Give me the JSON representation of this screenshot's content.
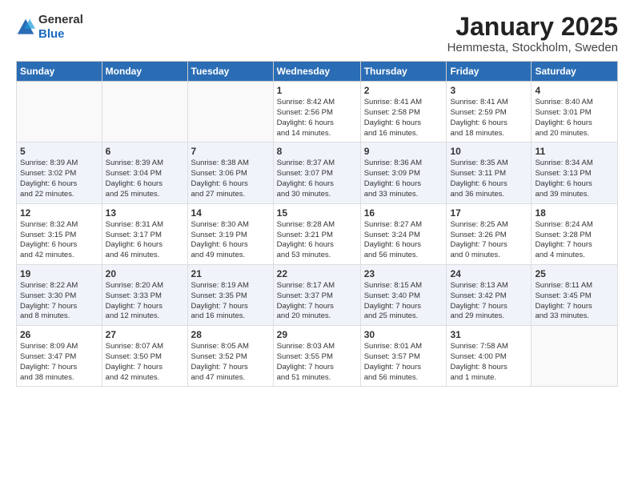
{
  "header": {
    "logo_general": "General",
    "logo_blue": "Blue",
    "title": "January 2025",
    "subtitle": "Hemmesta, Stockholm, Sweden"
  },
  "weekdays": [
    "Sunday",
    "Monday",
    "Tuesday",
    "Wednesday",
    "Thursday",
    "Friday",
    "Saturday"
  ],
  "weeks": [
    [
      {
        "day": "",
        "info": ""
      },
      {
        "day": "",
        "info": ""
      },
      {
        "day": "",
        "info": ""
      },
      {
        "day": "1",
        "info": "Sunrise: 8:42 AM\nSunset: 2:56 PM\nDaylight: 6 hours\nand 14 minutes."
      },
      {
        "day": "2",
        "info": "Sunrise: 8:41 AM\nSunset: 2:58 PM\nDaylight: 6 hours\nand 16 minutes."
      },
      {
        "day": "3",
        "info": "Sunrise: 8:41 AM\nSunset: 2:59 PM\nDaylight: 6 hours\nand 18 minutes."
      },
      {
        "day": "4",
        "info": "Sunrise: 8:40 AM\nSunset: 3:01 PM\nDaylight: 6 hours\nand 20 minutes."
      }
    ],
    [
      {
        "day": "5",
        "info": "Sunrise: 8:39 AM\nSunset: 3:02 PM\nDaylight: 6 hours\nand 22 minutes."
      },
      {
        "day": "6",
        "info": "Sunrise: 8:39 AM\nSunset: 3:04 PM\nDaylight: 6 hours\nand 25 minutes."
      },
      {
        "day": "7",
        "info": "Sunrise: 8:38 AM\nSunset: 3:06 PM\nDaylight: 6 hours\nand 27 minutes."
      },
      {
        "day": "8",
        "info": "Sunrise: 8:37 AM\nSunset: 3:07 PM\nDaylight: 6 hours\nand 30 minutes."
      },
      {
        "day": "9",
        "info": "Sunrise: 8:36 AM\nSunset: 3:09 PM\nDaylight: 6 hours\nand 33 minutes."
      },
      {
        "day": "10",
        "info": "Sunrise: 8:35 AM\nSunset: 3:11 PM\nDaylight: 6 hours\nand 36 minutes."
      },
      {
        "day": "11",
        "info": "Sunrise: 8:34 AM\nSunset: 3:13 PM\nDaylight: 6 hours\nand 39 minutes."
      }
    ],
    [
      {
        "day": "12",
        "info": "Sunrise: 8:32 AM\nSunset: 3:15 PM\nDaylight: 6 hours\nand 42 minutes."
      },
      {
        "day": "13",
        "info": "Sunrise: 8:31 AM\nSunset: 3:17 PM\nDaylight: 6 hours\nand 46 minutes."
      },
      {
        "day": "14",
        "info": "Sunrise: 8:30 AM\nSunset: 3:19 PM\nDaylight: 6 hours\nand 49 minutes."
      },
      {
        "day": "15",
        "info": "Sunrise: 8:28 AM\nSunset: 3:21 PM\nDaylight: 6 hours\nand 53 minutes."
      },
      {
        "day": "16",
        "info": "Sunrise: 8:27 AM\nSunset: 3:24 PM\nDaylight: 6 hours\nand 56 minutes."
      },
      {
        "day": "17",
        "info": "Sunrise: 8:25 AM\nSunset: 3:26 PM\nDaylight: 7 hours\nand 0 minutes."
      },
      {
        "day": "18",
        "info": "Sunrise: 8:24 AM\nSunset: 3:28 PM\nDaylight: 7 hours\nand 4 minutes."
      }
    ],
    [
      {
        "day": "19",
        "info": "Sunrise: 8:22 AM\nSunset: 3:30 PM\nDaylight: 7 hours\nand 8 minutes."
      },
      {
        "day": "20",
        "info": "Sunrise: 8:20 AM\nSunset: 3:33 PM\nDaylight: 7 hours\nand 12 minutes."
      },
      {
        "day": "21",
        "info": "Sunrise: 8:19 AM\nSunset: 3:35 PM\nDaylight: 7 hours\nand 16 minutes."
      },
      {
        "day": "22",
        "info": "Sunrise: 8:17 AM\nSunset: 3:37 PM\nDaylight: 7 hours\nand 20 minutes."
      },
      {
        "day": "23",
        "info": "Sunrise: 8:15 AM\nSunset: 3:40 PM\nDaylight: 7 hours\nand 25 minutes."
      },
      {
        "day": "24",
        "info": "Sunrise: 8:13 AM\nSunset: 3:42 PM\nDaylight: 7 hours\nand 29 minutes."
      },
      {
        "day": "25",
        "info": "Sunrise: 8:11 AM\nSunset: 3:45 PM\nDaylight: 7 hours\nand 33 minutes."
      }
    ],
    [
      {
        "day": "26",
        "info": "Sunrise: 8:09 AM\nSunset: 3:47 PM\nDaylight: 7 hours\nand 38 minutes."
      },
      {
        "day": "27",
        "info": "Sunrise: 8:07 AM\nSunset: 3:50 PM\nDaylight: 7 hours\nand 42 minutes."
      },
      {
        "day": "28",
        "info": "Sunrise: 8:05 AM\nSunset: 3:52 PM\nDaylight: 7 hours\nand 47 minutes."
      },
      {
        "day": "29",
        "info": "Sunrise: 8:03 AM\nSunset: 3:55 PM\nDaylight: 7 hours\nand 51 minutes."
      },
      {
        "day": "30",
        "info": "Sunrise: 8:01 AM\nSunset: 3:57 PM\nDaylight: 7 hours\nand 56 minutes."
      },
      {
        "day": "31",
        "info": "Sunrise: 7:58 AM\nSunset: 4:00 PM\nDaylight: 8 hours\nand 1 minute."
      },
      {
        "day": "",
        "info": ""
      }
    ]
  ]
}
